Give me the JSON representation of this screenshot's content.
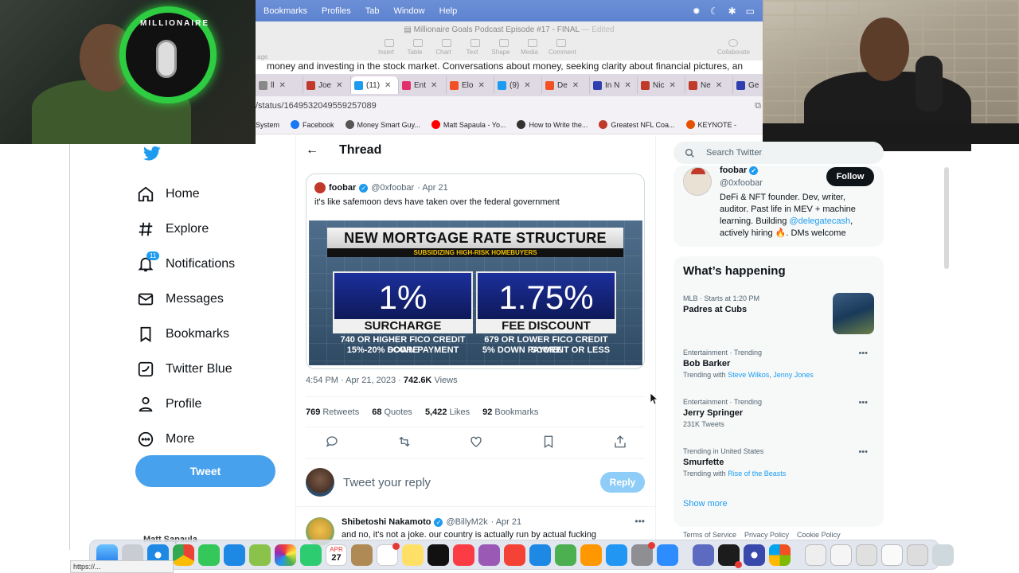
{
  "mac_menu": {
    "items": [
      "Bookmarks",
      "Profiles",
      "Tab",
      "Window",
      "Help"
    ]
  },
  "pages_doc": {
    "title": "Millionaire Goals Podcast Episode #17 - FINAL",
    "title_status": "— Edited",
    "left_fragment": "age",
    "toolbar": [
      "Insert",
      "Table",
      "Chart",
      "Text",
      "Shape",
      "Media",
      "Comment"
    ],
    "collaborate_label": "Collaborate",
    "body_line": "money and investing in the stock market. Conversations about money, seeking clarity about financial pictures, an"
  },
  "logo": {
    "text": "MILLIONAIRE"
  },
  "browser": {
    "tabs": [
      {
        "label": "ll",
        "color": "#888888"
      },
      {
        "label": "Joe",
        "color": "#c0392b"
      },
      {
        "label": "(11)",
        "color": "#1d9bf0",
        "active": true
      },
      {
        "label": "Ent",
        "color": "#e1306c"
      },
      {
        "label": "Elo",
        "color": "#f25022"
      },
      {
        "label": "(9)",
        "color": "#1d9bf0"
      },
      {
        "label": "De",
        "color": "#f25022"
      },
      {
        "label": "In N",
        "color": "#2f3fb0"
      },
      {
        "label": "Nic",
        "color": "#c0392b"
      },
      {
        "label": "Ne",
        "color": "#c0392b"
      },
      {
        "label": "Ge",
        "color": "#2f3fb0"
      }
    ],
    "address": "/status/1649532049559257089",
    "bookmarks": [
      {
        "label": "System",
        "color": "#888888"
      },
      {
        "label": "Facebook",
        "color": "#1877f2"
      },
      {
        "label": "Money Smart Guy...",
        "color": "#555555"
      },
      {
        "label": "Matt Sapaula - Yo...",
        "color": "#ff0000"
      },
      {
        "label": "How to Write the...",
        "color": "#333333"
      },
      {
        "label": "Greatest NFL Coa...",
        "color": "#c0392b"
      },
      {
        "label": "KEYNOTE - ",
        "color": "#e65100"
      }
    ],
    "status_url": "https://..."
  },
  "twitter": {
    "nav": [
      {
        "label": "Home",
        "icon": "home-icon"
      },
      {
        "label": "Explore",
        "icon": "hashtag-icon"
      },
      {
        "label": "Notifications",
        "icon": "bell-icon",
        "badge": "11"
      },
      {
        "label": "Messages",
        "icon": "envelope-icon"
      },
      {
        "label": "Bookmarks",
        "icon": "bookmark-icon"
      },
      {
        "label": "Twitter Blue",
        "icon": "twitter-blue-icon"
      },
      {
        "label": "Profile",
        "icon": "person-icon"
      },
      {
        "label": "More",
        "icon": "more-icon"
      }
    ],
    "tweet_button": "Tweet",
    "account_peek": "Matt Sapaula",
    "thread_title": "Thread",
    "quoted": {
      "name": "foobar",
      "handle": "@0xfoobar",
      "date": "· Apr 21",
      "text": "it's like safemoon devs have taken over the federal government"
    },
    "news_graphic": {
      "title": "NEW MORTGAGE RATE STRUCTURE",
      "subtitle": "SUBSIDIZING HIGH-RISK HOMEBUYERS",
      "left": {
        "value": "1%",
        "label": "SURCHARGE",
        "note1": "740 OR HIGHER FICO CREDIT SCORE",
        "note2": "15%-20% DOWN PAYMENT"
      },
      "right": {
        "value": "1.75%",
        "label": "FEE DISCOUNT",
        "note1": "679 OR LOWER FICO CREDIT SCORE",
        "note2": "5% DOWN PAYMENT OR LESS"
      }
    },
    "meta": {
      "time": "4:54 PM · Apr 21, 2023 · ",
      "views": "742.6K",
      "views_label": " Views"
    },
    "stats": [
      {
        "value": "769",
        "label": "Retweets"
      },
      {
        "value": "68",
        "label": "Quotes"
      },
      {
        "value": "5,422",
        "label": "Likes"
      },
      {
        "value": "92",
        "label": "Bookmarks"
      }
    ],
    "reply": {
      "placeholder": "Tweet your reply",
      "button": "Reply"
    },
    "next_tweet": {
      "name": "Shibetoshi Nakamoto",
      "handle": "@BillyM2k",
      "date": "· Apr 21",
      "text": "and no, it's not a joke. our country is actually run by actual fucking"
    },
    "search_placeholder": "Search Twitter",
    "profile_card": {
      "name": "foobar",
      "handle": "@0xfoobar",
      "follow": "Follow",
      "bio_1": "DeFi & NFT founder. Dev, writer, auditor. Past life in MEV + machine learning. Building ",
      "bio_link": "@delegatecash",
      "bio_2": ", actively hiring 🔥. DMs welcome"
    },
    "whats_happening": {
      "title": "What’s happening",
      "trends": [
        {
          "context": "MLB · Starts at 1:20 PM",
          "name": "Padres at Cubs",
          "sub": ""
        },
        {
          "context": "Entertainment · Trending",
          "name": "Bob Barker",
          "sub_prefix": "Trending with ",
          "links": [
            "Steve Wilkos",
            "Jenny Jones"
          ]
        },
        {
          "context": "Entertainment · Trending",
          "name": "Jerry Springer",
          "sub": "231K Tweets"
        },
        {
          "context": "Trending in United States",
          "name": "Smurfette",
          "sub_prefix": "Trending with ",
          "links": [
            "Rise of the Beasts"
          ]
        }
      ],
      "show_more": "Show more"
    },
    "footer": [
      "Terms of Service",
      "Privacy Policy",
      "Cookie Policy"
    ]
  },
  "dock": {
    "calendar_month": "APR",
    "calendar_day": "27"
  }
}
